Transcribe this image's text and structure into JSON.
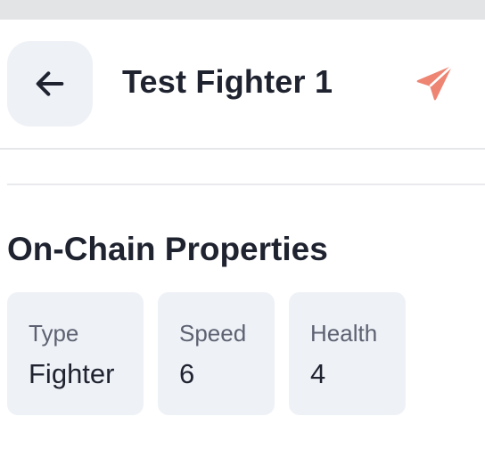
{
  "header": {
    "title": "Test Fighter 1",
    "back_icon": "arrow-left-icon",
    "send_icon": "send-icon",
    "send_color": "#ee8472"
  },
  "section": {
    "title": "On-Chain Properties"
  },
  "properties": [
    {
      "label": "Type",
      "value": "Fighter"
    },
    {
      "label": "Speed",
      "value": "6"
    },
    {
      "label": "Health",
      "value": "4"
    }
  ],
  "colors": {
    "card_bg": "#eef1f6",
    "text": "#1f2330",
    "muted": "#5d6272",
    "accent": "#ee8472"
  }
}
